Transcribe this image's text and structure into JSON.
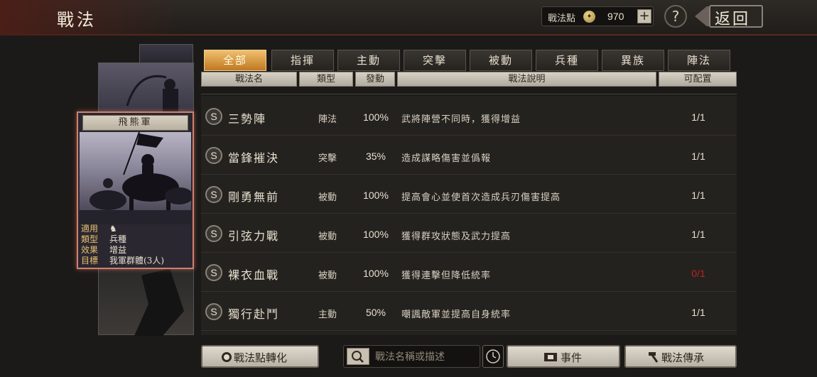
{
  "header": {
    "title": "戰法",
    "points_label": "戰法點",
    "points_value": "970",
    "plus_label": "+",
    "help_label": "?",
    "back_label": "返回"
  },
  "card": {
    "name": "飛熊軍",
    "info": [
      {
        "key": "適用",
        "value": ""
      },
      {
        "key": "類型",
        "value": "兵種"
      },
      {
        "key": "效果",
        "value": "增益"
      },
      {
        "key": "目標",
        "value": "我軍群體(3人)"
      }
    ]
  },
  "tabs": [
    "全部",
    "指揮",
    "主動",
    "突擊",
    "被動",
    "兵種",
    "異族",
    "陣法"
  ],
  "columns": {
    "name": "戰法名",
    "type": "類型",
    "rate": "發動",
    "desc": "戰法說明",
    "alloc": "可配置"
  },
  "rows": [
    {
      "grade": "S",
      "name": "三勢陣",
      "type": "陣法",
      "rate": "100%",
      "desc": "武將陣營不同時，獲得增益",
      "alloc": "1/1"
    },
    {
      "grade": "S",
      "name": "當鋒摧決",
      "type": "突擊",
      "rate": "35%",
      "desc": "造成謀略傷害並僞報",
      "alloc": "1/1"
    },
    {
      "grade": "S",
      "name": "剛勇無前",
      "type": "被動",
      "rate": "100%",
      "desc": "提高會心並使首次造成兵刃傷害提高",
      "alloc": "1/1"
    },
    {
      "grade": "S",
      "name": "引弦力戰",
      "type": "被動",
      "rate": "100%",
      "desc": "獲得群攻狀態及武力提高",
      "alloc": "1/1"
    },
    {
      "grade": "S",
      "name": "裸衣血戰",
      "type": "被動",
      "rate": "100%",
      "desc": "獲得連擊但降低統率",
      "alloc": "0/1"
    },
    {
      "grade": "S",
      "name": "獨行赴鬥",
      "type": "主動",
      "rate": "50%",
      "desc": "嘲諷敵軍並提高自身統率",
      "alloc": "1/1"
    }
  ],
  "bottom": {
    "convert_label": "戰法點轉化",
    "search_placeholder": "戰法名稱或描述",
    "event_label": "事件",
    "inherit_label": "戰法傳承"
  },
  "colors": {
    "accent": "#e8a040",
    "unavailable": "#c02020"
  }
}
